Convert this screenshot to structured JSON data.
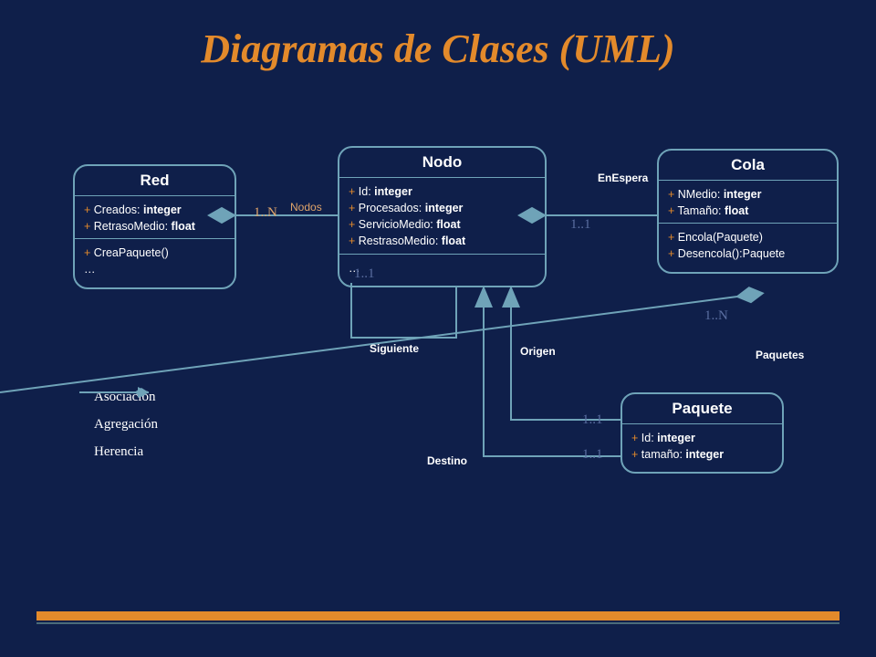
{
  "title": "Diagramas de Clases (UML)",
  "classes": {
    "red": {
      "name": "Red",
      "attrs": [
        {
          "p": "+",
          "n": "Creados",
          "t": "integer"
        },
        {
          "p": "+",
          "n": "RetrasoMedio",
          "t": "float"
        }
      ],
      "ops": [
        "+ CreaPaquete()",
        "…"
      ]
    },
    "nodo": {
      "name": "Nodo",
      "attrs": [
        {
          "p": "+",
          "n": "Id",
          "t": "integer"
        },
        {
          "p": "+",
          "n": "Procesados",
          "t": "integer"
        },
        {
          "p": "+",
          "n": "ServicioMedio",
          "t": "float"
        },
        {
          "p": "+",
          "n": "RestrasoMedio",
          "t": "float"
        }
      ],
      "ops": [
        "…"
      ]
    },
    "cola": {
      "name": "Cola",
      "attrs": [
        {
          "p": "+",
          "n": "NMedio",
          "t": "integer"
        },
        {
          "p": "+",
          "n": "Tamaño",
          "t": "float"
        }
      ],
      "ops": [
        "+ Encola(Paquete)",
        "+ Desencola():Paquete"
      ]
    },
    "paquete": {
      "name": "Paquete",
      "attrs": [
        {
          "p": "+",
          "n": "Id",
          "t": "integer"
        },
        {
          "p": "+",
          "n": "tamaño",
          "t": "integer"
        }
      ],
      "ops": []
    }
  },
  "labels": {
    "nodos": "Nodos",
    "enespera": "EnEspera",
    "siguiente": "Siguiente",
    "origen": "Origen",
    "destino": "Destino",
    "paquetes": "Paquetes"
  },
  "mult": {
    "red_1n": "1..N",
    "nodo_11a": "1..1",
    "nodo_11b": "1..1",
    "cola_1n": "1..N",
    "paq_11a": "1..1",
    "paq_11b": "1..1"
  },
  "legend": {
    "asoc": "Asociación",
    "agr": "Agregación",
    "her": "Herencia"
  },
  "colors": {
    "line": "#6fa3b8",
    "accent": "#e38a2b"
  }
}
